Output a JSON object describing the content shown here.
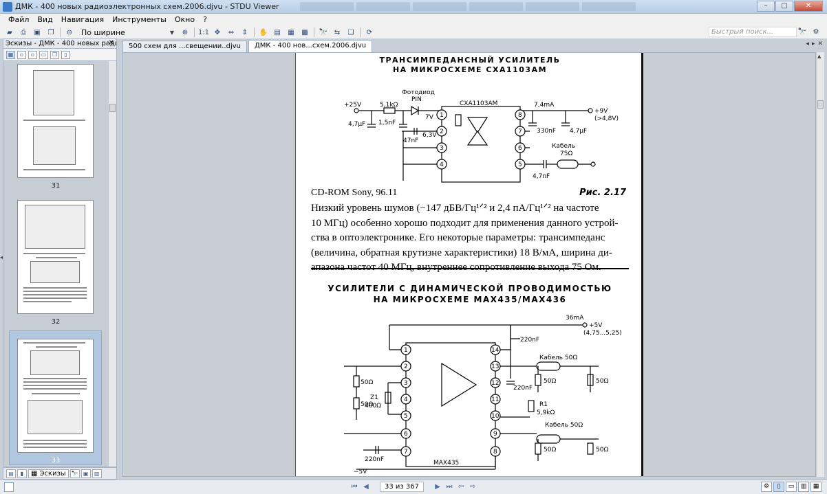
{
  "window": {
    "title": "ДМК - 400 новых радиоэлектронных схем.2006.djvu - STDU Viewer"
  },
  "menu": [
    "Файл",
    "Вид",
    "Навигация",
    "Инструменты",
    "Окно",
    "?"
  ],
  "toolbar": {
    "zoom_value": "По ширине",
    "search_placeholder": "Быстрый поиск...",
    "fit_label": "1:1"
  },
  "sidebar": {
    "header": "Эскизы - ДМК - 400 новых радио",
    "thumbnails": [
      {
        "label": "31"
      },
      {
        "label": "32"
      },
      {
        "label": "33"
      }
    ],
    "tab_label": "Эскизы"
  },
  "tabs": [
    {
      "label": "500 схем для ...свещении..djvu",
      "active": false
    },
    {
      "label": "ДМК - 400 нов...схем.2006.djvu",
      "active": true
    }
  ],
  "page": {
    "title1_line1": "ТРАНСИМПЕДАНСНЫЙ УСИЛИТЕЛЬ",
    "title1_line2": "НА МИКРОСХЕМЕ CXA1103AM",
    "caption_left": "CD-ROM Sony, 96.11",
    "caption_right": "Рис. 2.17",
    "body_lines": [
      "Низкий уровень шумов (−147 дБВ/Гц¹ᐟ² и 2,4 пА/Гц¹ᐟ² на частоте",
      "10 МГц) особенно хорошо подходит для применения данного устрой-",
      "ства в оптоэлектронике. Его некоторые параметры: трансимпеданс",
      "(величина, обратная крутизне характеристики) 18 В/мА, ширина ди-",
      "апазона частот 40 МГц, внутреннее сопротивление выхода 75 Ом."
    ],
    "title2_line1": "УСИЛИТЕЛИ С ДИНАМИЧЕСКОЙ ПРОВОДИМОСТЬЮ",
    "title2_line2": "НА МИКРОСХЕМЕ MAX435/MAX436",
    "circuit1": {
      "chip": "CXA1103AM",
      "photodiode": "Фотодиод",
      "pin": "PIN",
      "v_in": "+25V",
      "r1": "5,1kΩ",
      "c1": "1,5nF",
      "c2": "4,7μF",
      "v7": "7V",
      "c3": "47nF",
      "v63": "6,3V",
      "i74": "7,4mA",
      "v_out": "+9V",
      "v_out2": "(>4,8V)",
      "c330": "330nF",
      "c47u": "4,7μF",
      "cable": "Кабель",
      "r75": "75Ω",
      "c47n": "4,7nF",
      "pins": [
        "1",
        "2",
        "3",
        "4",
        "8",
        "7",
        "6",
        "5"
      ]
    },
    "circuit2": {
      "chip": "MAX435",
      "i36": "36mA",
      "v5": "+5V",
      "v5r": "(4,75...5,25)",
      "c220a": "220nF",
      "c220b": "220nF",
      "c220c": "220nF",
      "cable1": "Кабель  50Ω",
      "cable2": "Кабель  50Ω",
      "r50": "50Ω",
      "z1": "Z1",
      "r400": "400Ω",
      "r1": "R1",
      "r59": "5,9kΩ",
      "vneg": "−5V",
      "pins_left": [
        "1",
        "2",
        "3",
        "4",
        "5",
        "6",
        "7"
      ],
      "pins_right": [
        "14",
        "13",
        "12",
        "11",
        "10",
        "9",
        "8"
      ]
    }
  },
  "status": {
    "page_info": "33 из 367"
  },
  "colors": {
    "accent": "#3a78c8",
    "selection": "#b0c7df",
    "viewer_bg": "#c8cdd3"
  }
}
